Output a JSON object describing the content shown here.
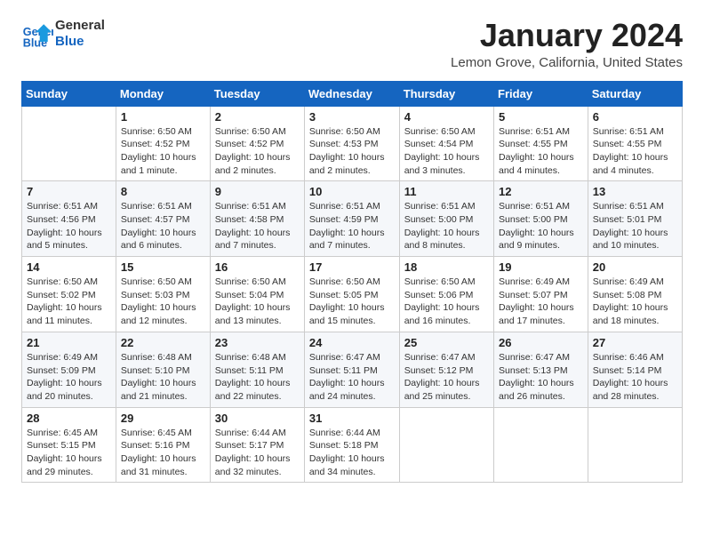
{
  "header": {
    "logo_line1": "General",
    "logo_line2": "Blue",
    "month": "January 2024",
    "location": "Lemon Grove, California, United States"
  },
  "days_of_week": [
    "Sunday",
    "Monday",
    "Tuesday",
    "Wednesday",
    "Thursday",
    "Friday",
    "Saturday"
  ],
  "weeks": [
    [
      {
        "day": "",
        "info": ""
      },
      {
        "day": "1",
        "info": "Sunrise: 6:50 AM\nSunset: 4:52 PM\nDaylight: 10 hours\nand 1 minute."
      },
      {
        "day": "2",
        "info": "Sunrise: 6:50 AM\nSunset: 4:52 PM\nDaylight: 10 hours\nand 2 minutes."
      },
      {
        "day": "3",
        "info": "Sunrise: 6:50 AM\nSunset: 4:53 PM\nDaylight: 10 hours\nand 2 minutes."
      },
      {
        "day": "4",
        "info": "Sunrise: 6:50 AM\nSunset: 4:54 PM\nDaylight: 10 hours\nand 3 minutes."
      },
      {
        "day": "5",
        "info": "Sunrise: 6:51 AM\nSunset: 4:55 PM\nDaylight: 10 hours\nand 4 minutes."
      },
      {
        "day": "6",
        "info": "Sunrise: 6:51 AM\nSunset: 4:55 PM\nDaylight: 10 hours\nand 4 minutes."
      }
    ],
    [
      {
        "day": "7",
        "info": "Sunrise: 6:51 AM\nSunset: 4:56 PM\nDaylight: 10 hours\nand 5 minutes."
      },
      {
        "day": "8",
        "info": "Sunrise: 6:51 AM\nSunset: 4:57 PM\nDaylight: 10 hours\nand 6 minutes."
      },
      {
        "day": "9",
        "info": "Sunrise: 6:51 AM\nSunset: 4:58 PM\nDaylight: 10 hours\nand 7 minutes."
      },
      {
        "day": "10",
        "info": "Sunrise: 6:51 AM\nSunset: 4:59 PM\nDaylight: 10 hours\nand 7 minutes."
      },
      {
        "day": "11",
        "info": "Sunrise: 6:51 AM\nSunset: 5:00 PM\nDaylight: 10 hours\nand 8 minutes."
      },
      {
        "day": "12",
        "info": "Sunrise: 6:51 AM\nSunset: 5:00 PM\nDaylight: 10 hours\nand 9 minutes."
      },
      {
        "day": "13",
        "info": "Sunrise: 6:51 AM\nSunset: 5:01 PM\nDaylight: 10 hours\nand 10 minutes."
      }
    ],
    [
      {
        "day": "14",
        "info": "Sunrise: 6:50 AM\nSunset: 5:02 PM\nDaylight: 10 hours\nand 11 minutes."
      },
      {
        "day": "15",
        "info": "Sunrise: 6:50 AM\nSunset: 5:03 PM\nDaylight: 10 hours\nand 12 minutes."
      },
      {
        "day": "16",
        "info": "Sunrise: 6:50 AM\nSunset: 5:04 PM\nDaylight: 10 hours\nand 13 minutes."
      },
      {
        "day": "17",
        "info": "Sunrise: 6:50 AM\nSunset: 5:05 PM\nDaylight: 10 hours\nand 15 minutes."
      },
      {
        "day": "18",
        "info": "Sunrise: 6:50 AM\nSunset: 5:06 PM\nDaylight: 10 hours\nand 16 minutes."
      },
      {
        "day": "19",
        "info": "Sunrise: 6:49 AM\nSunset: 5:07 PM\nDaylight: 10 hours\nand 17 minutes."
      },
      {
        "day": "20",
        "info": "Sunrise: 6:49 AM\nSunset: 5:08 PM\nDaylight: 10 hours\nand 18 minutes."
      }
    ],
    [
      {
        "day": "21",
        "info": "Sunrise: 6:49 AM\nSunset: 5:09 PM\nDaylight: 10 hours\nand 20 minutes."
      },
      {
        "day": "22",
        "info": "Sunrise: 6:48 AM\nSunset: 5:10 PM\nDaylight: 10 hours\nand 21 minutes."
      },
      {
        "day": "23",
        "info": "Sunrise: 6:48 AM\nSunset: 5:11 PM\nDaylight: 10 hours\nand 22 minutes."
      },
      {
        "day": "24",
        "info": "Sunrise: 6:47 AM\nSunset: 5:11 PM\nDaylight: 10 hours\nand 24 minutes."
      },
      {
        "day": "25",
        "info": "Sunrise: 6:47 AM\nSunset: 5:12 PM\nDaylight: 10 hours\nand 25 minutes."
      },
      {
        "day": "26",
        "info": "Sunrise: 6:47 AM\nSunset: 5:13 PM\nDaylight: 10 hours\nand 26 minutes."
      },
      {
        "day": "27",
        "info": "Sunrise: 6:46 AM\nSunset: 5:14 PM\nDaylight: 10 hours\nand 28 minutes."
      }
    ],
    [
      {
        "day": "28",
        "info": "Sunrise: 6:45 AM\nSunset: 5:15 PM\nDaylight: 10 hours\nand 29 minutes."
      },
      {
        "day": "29",
        "info": "Sunrise: 6:45 AM\nSunset: 5:16 PM\nDaylight: 10 hours\nand 31 minutes."
      },
      {
        "day": "30",
        "info": "Sunrise: 6:44 AM\nSunset: 5:17 PM\nDaylight: 10 hours\nand 32 minutes."
      },
      {
        "day": "31",
        "info": "Sunrise: 6:44 AM\nSunset: 5:18 PM\nDaylight: 10 hours\nand 34 minutes."
      },
      {
        "day": "",
        "info": ""
      },
      {
        "day": "",
        "info": ""
      },
      {
        "day": "",
        "info": ""
      }
    ]
  ]
}
